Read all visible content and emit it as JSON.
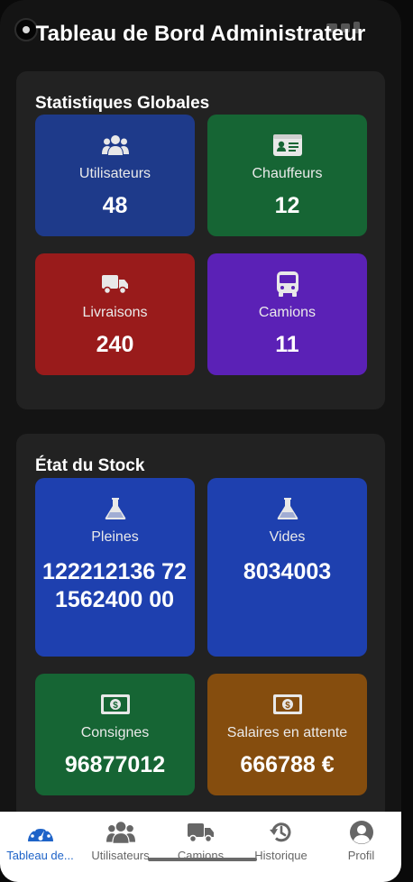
{
  "header": {
    "title": "Tableau de Bord Administrateur"
  },
  "global_stats": {
    "title": "Statistiques Globales",
    "cards": [
      {
        "label": "Utilisateurs",
        "value": "48",
        "icon": "users-icon",
        "color": "#1e3a8a"
      },
      {
        "label": "Chauffeurs",
        "value": "12",
        "icon": "id-card-icon",
        "color": "#166534"
      },
      {
        "label": "Livraisons",
        "value": "240",
        "icon": "truck-icon",
        "color": "#991b1b"
      },
      {
        "label": "Camions",
        "value": "11",
        "icon": "bus-icon",
        "color": "#5b21b6"
      }
    ]
  },
  "stock": {
    "title": "État du Stock",
    "cards": [
      {
        "label": "Pleines",
        "value": "122212136 721562400 00",
        "icon": "flask-icon",
        "color": "#1e40af"
      },
      {
        "label": "Vides",
        "value": "8034003",
        "icon": "flask-icon",
        "color": "#1e40af"
      },
      {
        "label": "Consignes",
        "value": "96877012",
        "icon": "money-bill-icon",
        "color": "#166534"
      },
      {
        "label": "Salaires en attente",
        "value": "666788 €",
        "icon": "money-bill-icon",
        "color": "#854d0e"
      }
    ]
  },
  "nav": {
    "items": [
      {
        "label": "Tableau de...",
        "icon": "dashboard-gauge-icon",
        "active": true
      },
      {
        "label": "Utilisateurs",
        "icon": "users-icon",
        "active": false
      },
      {
        "label": "Camions",
        "icon": "truck-icon",
        "active": false
      },
      {
        "label": "Historique",
        "icon": "history-icon",
        "active": false
      },
      {
        "label": "Profil",
        "icon": "profile-icon",
        "active": false
      }
    ],
    "active_color": "#1e63c8",
    "inactive_color": "#666666"
  }
}
